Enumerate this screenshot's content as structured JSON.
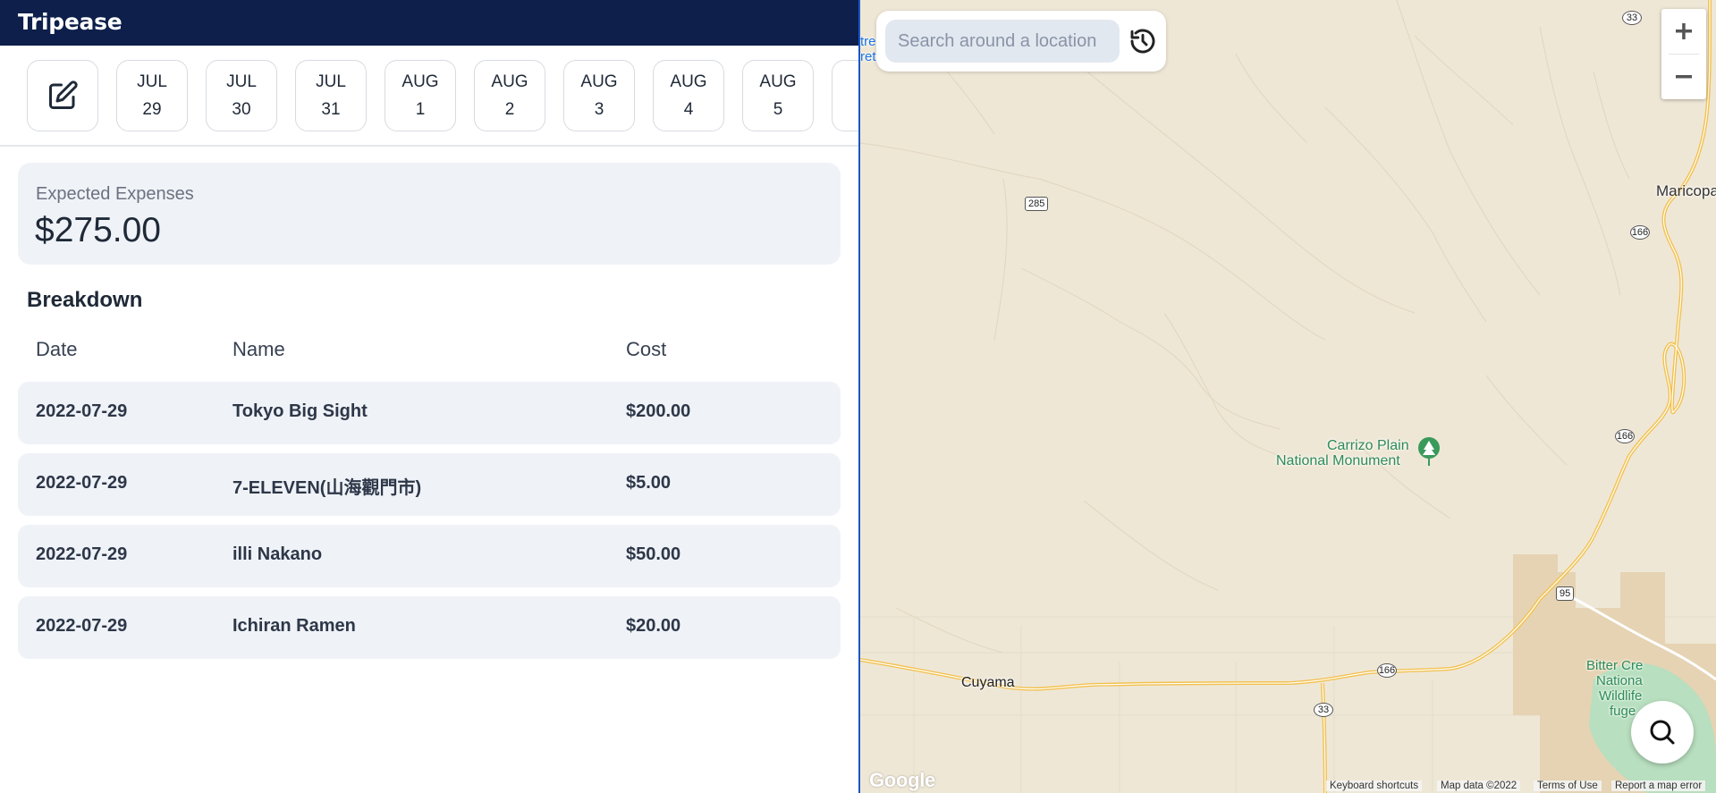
{
  "app": {
    "title": "Tripease"
  },
  "dates": [
    {
      "month": "JUL",
      "day": "29"
    },
    {
      "month": "JUL",
      "day": "30"
    },
    {
      "month": "JUL",
      "day": "31"
    },
    {
      "month": "AUG",
      "day": "1"
    },
    {
      "month": "AUG",
      "day": "2"
    },
    {
      "month": "AUG",
      "day": "3"
    },
    {
      "month": "AUG",
      "day": "4"
    },
    {
      "month": "AUG",
      "day": "5"
    }
  ],
  "expenses": {
    "label": "Expected Expenses",
    "value": "$275.00"
  },
  "breakdown": {
    "title": "Breakdown",
    "columns": {
      "date": "Date",
      "name": "Name",
      "cost": "Cost"
    },
    "rows": [
      {
        "date": "2022-07-29",
        "name": "Tokyo Big Sight",
        "cost": "$200.00"
      },
      {
        "date": "2022-07-29",
        "name": "7-ELEVEN(山海觀門市)",
        "cost": "$5.00"
      },
      {
        "date": "2022-07-29",
        "name": "illi Nakano",
        "cost": "$50.00"
      },
      {
        "date": "2022-07-29",
        "name": "Ichiran Ramen",
        "cost": "$20.00"
      }
    ]
  },
  "map": {
    "search_placeholder": "Search around a location",
    "labels": {
      "maricopa": "Maricopa",
      "carrizo": "Carrizo Plain",
      "carrizo2": "National Monument",
      "cuyama": "Cuyama",
      "bitter1": "Bitter Cre",
      "bitter2": "Nationa",
      "bitter3": "Wildlife",
      "bitter4": "fuge",
      "edge1": "tre",
      "edge2": "ret"
    },
    "shields": {
      "r33a": "33",
      "r285": "285",
      "r166a": "166",
      "r166b": "166",
      "r166c": "166",
      "r95": "95",
      "r33b": "33"
    },
    "footer": {
      "keyboard": "Keyboard shortcuts",
      "mapdata": "Map data ©2022",
      "terms": "Terms of Use",
      "report": "Report a map error"
    },
    "logo": "Google"
  },
  "icons": {
    "edit": "edit-icon",
    "history": "history-icon",
    "zoom_in": "plus-icon",
    "zoom_out": "minus-icon",
    "search": "search-icon",
    "park": "tree-icon"
  }
}
